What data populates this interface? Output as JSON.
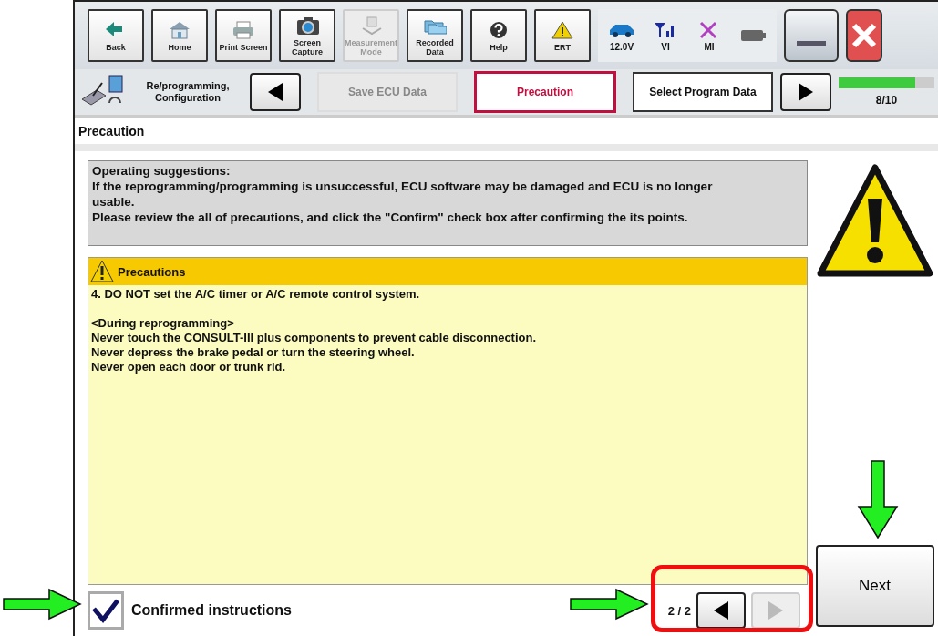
{
  "toolbar": {
    "buttons": [
      {
        "kind": "back",
        "label": "Back",
        "disabled": false
      },
      {
        "kind": "home",
        "label": "Home",
        "disabled": false
      },
      {
        "kind": "print",
        "label": "Print Screen",
        "disabled": false
      },
      {
        "kind": "camera",
        "label": "Screen Capture",
        "disabled": false
      },
      {
        "kind": "measure",
        "label": "Measurement Mode",
        "disabled": true
      },
      {
        "kind": "recorded",
        "label": "Recorded Data",
        "disabled": false
      },
      {
        "kind": "help",
        "label": "Help",
        "disabled": false
      },
      {
        "kind": "ert",
        "label": "ERT",
        "disabled": false
      }
    ],
    "indicators": [
      {
        "kind": "car",
        "label": "12.0V"
      },
      {
        "kind": "signal",
        "label": "VI"
      },
      {
        "kind": "cross",
        "label": "MI"
      },
      {
        "kind": "battery"
      }
    ]
  },
  "breadcrumb": {
    "label": "Re/programming, Configuration",
    "steps": [
      {
        "label": "Save ECU Data",
        "selected": false,
        "disabled": true
      },
      {
        "label": "Precaution",
        "selected": true,
        "disabled": false
      },
      {
        "label": "Select Program Data",
        "selected": false,
        "disabled": false
      }
    ],
    "progress": {
      "level": 0.8,
      "label": "8/10"
    }
  },
  "page_title": "Precaution",
  "suggestions": [
    "Operating suggestions:",
    "If the reprogramming/programming is unsuccessful, ECU software may be damaged and ECU is no longer usable.",
    "Please review the all of precautions, and click the \"Confirm\" check box after confirming the its points."
  ],
  "precautions": {
    "title": "Precautions",
    "paragraphs": [
      [
        "4. DO NOT set the A/C timer or A/C remote control system."
      ],
      [
        "<During reprogramming>",
        "Never touch the CONSULT-III plus components to prevent cable disconnection.",
        "Never depress the brake pedal or turn the steering wheel.",
        "Never open each door or trunk rid."
      ]
    ]
  },
  "confirm": {
    "label": "Confirmed instructions",
    "checked": true
  },
  "pager": {
    "label": "2 / 2",
    "prev_disabled": false,
    "next_disabled": true
  },
  "next_button": {
    "label": "Next"
  }
}
